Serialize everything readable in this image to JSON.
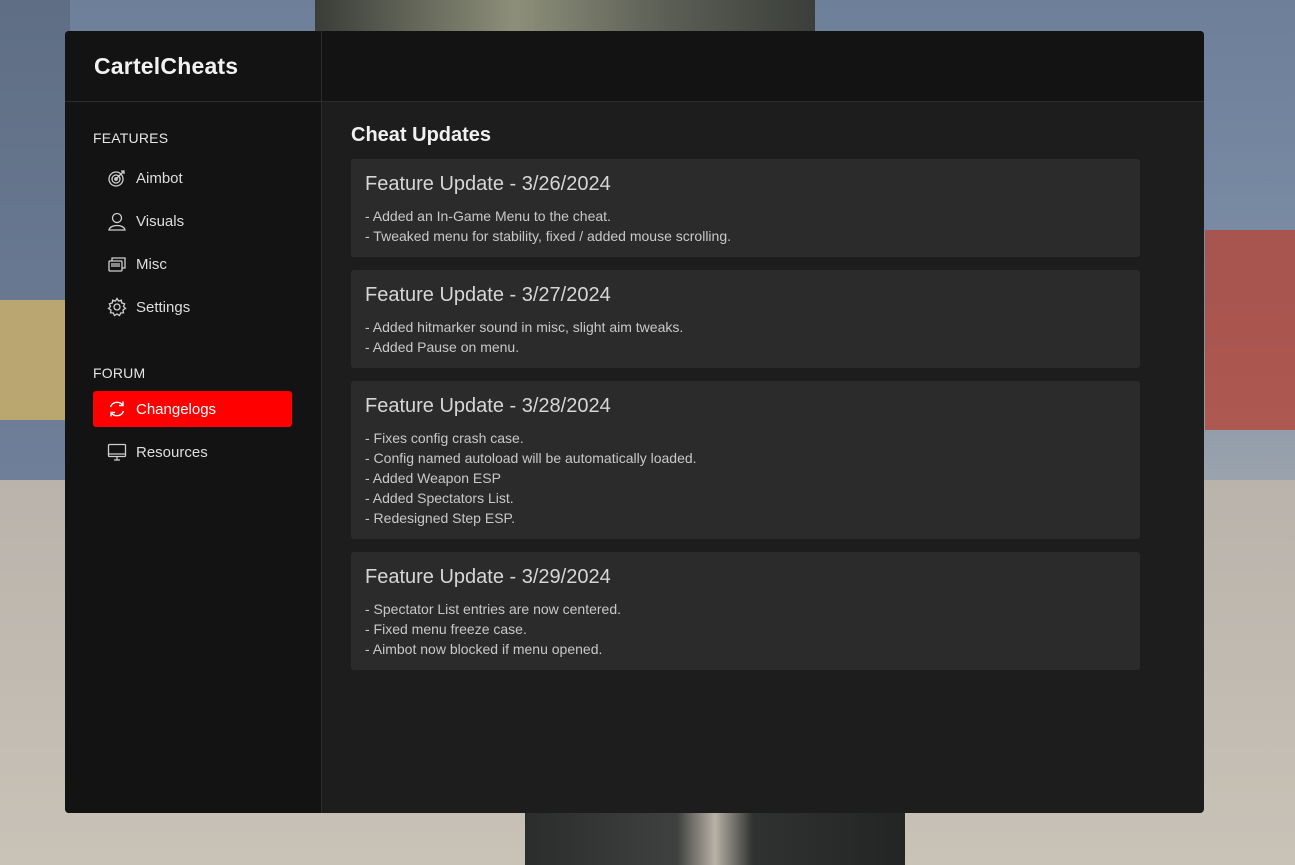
{
  "app": {
    "brand": "CartelCheats"
  },
  "sidebar": {
    "features_label": "FEATURES",
    "features": [
      {
        "label": "Aimbot",
        "icon": "target-icon"
      },
      {
        "label": "Visuals",
        "icon": "user-icon"
      },
      {
        "label": "Misc",
        "icon": "layers-icon"
      },
      {
        "label": "Settings",
        "icon": "gear-icon"
      }
    ],
    "forum_label": "FORUM",
    "forum": [
      {
        "label": "Changelogs",
        "icon": "refresh-icon",
        "active": true
      },
      {
        "label": "Resources",
        "icon": "monitor-icon",
        "active": false
      }
    ]
  },
  "main": {
    "title": "Cheat Updates",
    "updates": [
      {
        "title": "Feature Update - 3/26/2024",
        "lines": [
          "- Added an In-Game Menu to the cheat.",
          "- Tweaked menu for stability, fixed / added mouse scrolling."
        ]
      },
      {
        "title": "Feature Update - 3/27/2024",
        "lines": [
          "- Added hitmarker sound in misc, slight aim tweaks.",
          "- Added Pause on menu."
        ]
      },
      {
        "title": "Feature Update - 3/28/2024",
        "lines": [
          "- Fixes config crash case.",
          "- Config named autoload will be automatically loaded.",
          "- Added Weapon ESP",
          "- Added Spectators List.",
          "- Redesigned Step ESP."
        ]
      },
      {
        "title": "Feature Update - 3/29/2024",
        "lines": [
          "- Spectator List entries are now centered.",
          "- Fixed menu freeze case.",
          "- Aimbot now blocked if menu opened."
        ]
      }
    ]
  },
  "colors": {
    "accent": "#ff0000",
    "panel": "#131313",
    "content": "#1d1d1d",
    "card": "#2b2b2b"
  }
}
